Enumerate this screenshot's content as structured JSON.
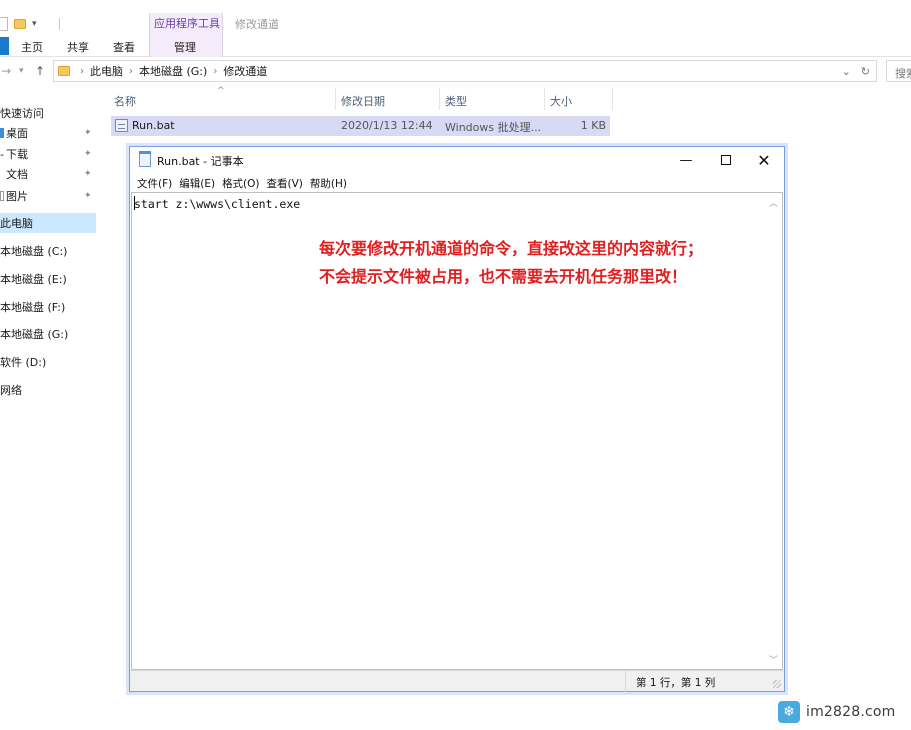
{
  "explorer": {
    "ribbon": {
      "tool_group_title": "应用程序工具",
      "context_title": "修改通道",
      "tabs": [
        "主页",
        "共享",
        "查看",
        "管理"
      ]
    },
    "address": {
      "crumbs": [
        "此电脑",
        "本地磁盘 (G:)",
        "修改通道"
      ],
      "search_placeholder": "搜索"
    },
    "nav": {
      "items": [
        {
          "label": "快速访问"
        },
        {
          "label": "桌面"
        },
        {
          "label": "下载"
        },
        {
          "label": "文档"
        },
        {
          "label": "图片"
        },
        {
          "label": "此电脑"
        },
        {
          "label": "本地磁盘 (C:)"
        },
        {
          "label": "本地磁盘 (E:)"
        },
        {
          "label": "本地磁盘 (F:)"
        },
        {
          "label": "本地磁盘 (G:)"
        },
        {
          "label": "软件 (D:)"
        },
        {
          "label": "网络"
        }
      ]
    },
    "columns": [
      "名称",
      "修改日期",
      "类型",
      "大小"
    ],
    "file": {
      "name": "Run.bat",
      "date": "2020/1/13 12:44",
      "type": "Windows 批处理...",
      "size": "1 KB"
    }
  },
  "notepad": {
    "title": "Run.bat - 记事本",
    "menu": [
      "文件(F)",
      "编辑(E)",
      "格式(O)",
      "查看(V)",
      "帮助(H)"
    ],
    "content": "start z:\\wwws\\client.exe",
    "annotation": [
      "每次要修改开机通道的命令，直接改这里的内容就行；",
      "不会提示文件被占用，也不需要去开机任务那里改！"
    ],
    "status": "第 1 行，第 1 列"
  },
  "watermark": {
    "text": "im2828.com"
  },
  "colors": {
    "selection": "#cce8ff",
    "file_row": "#d7d9f5",
    "annotation": "#e02020",
    "tool_group": "#f4ecfa"
  },
  "icons": [
    "folder-icon",
    "pin-icon",
    "bat-file-icon",
    "notepad-icon",
    "minimize-icon",
    "maximize-icon",
    "close-icon",
    "refresh-icon",
    "chevron-down-icon",
    "up-arrow-icon",
    "back-icon",
    "forward-icon",
    "logo-icon"
  ]
}
